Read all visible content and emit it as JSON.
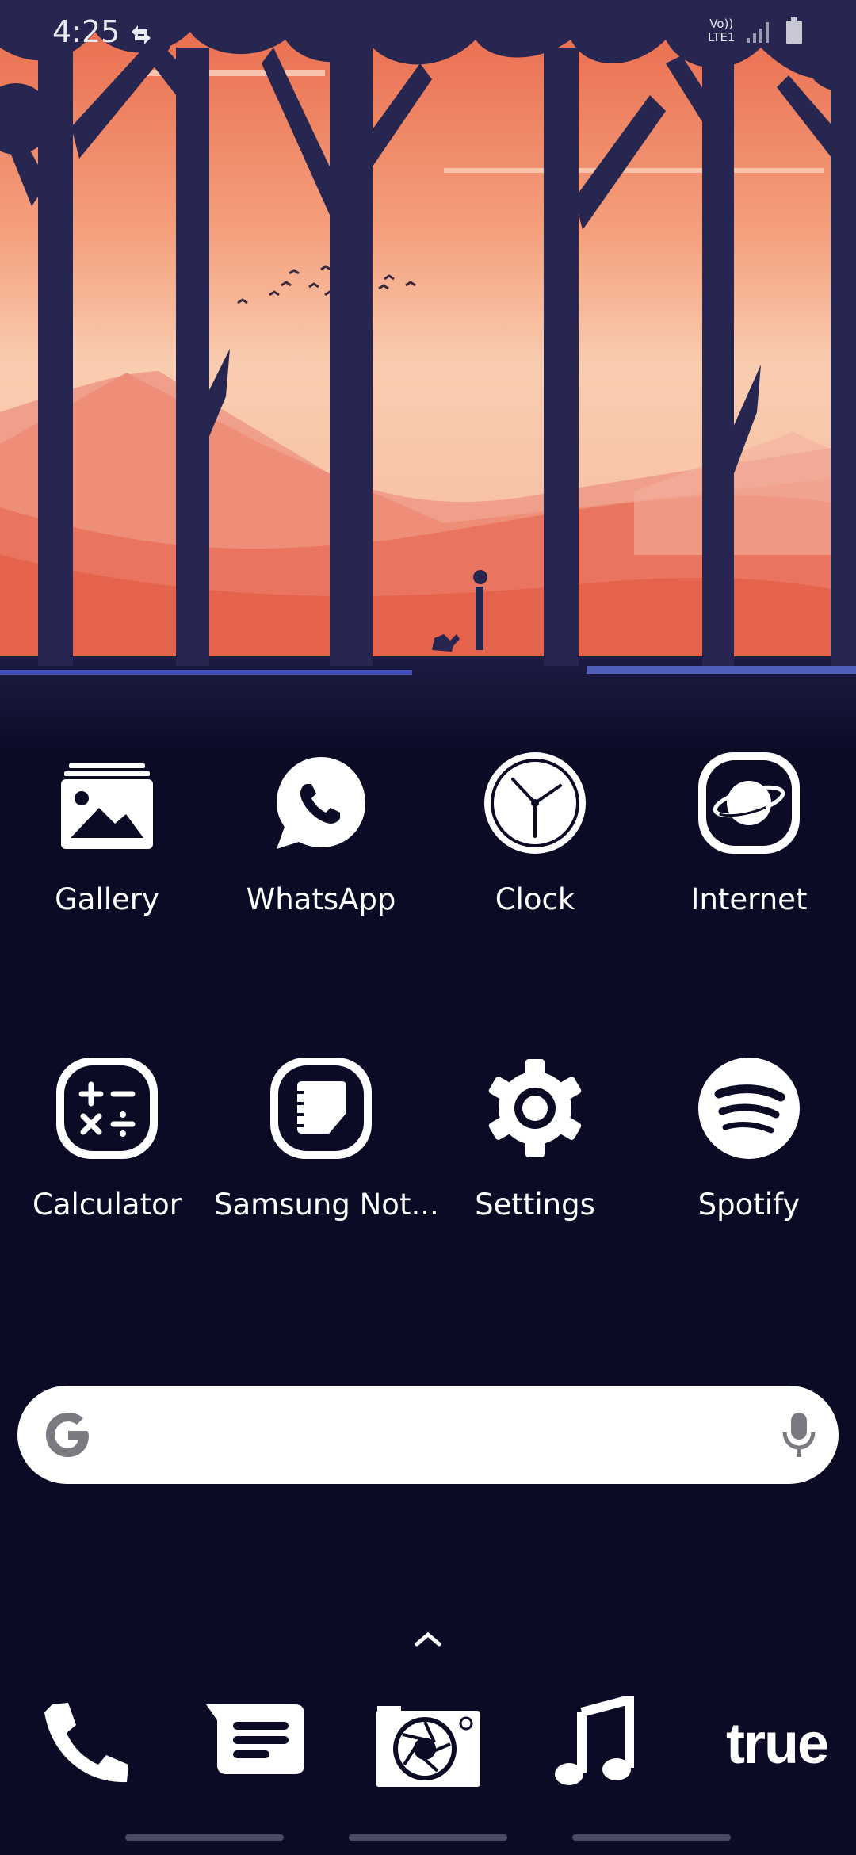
{
  "statusbar": {
    "time": "4:25",
    "network_label_top": "Vo))",
    "network_label_bottom": "LTE1"
  },
  "apps_row1": [
    {
      "label": "Gallery",
      "icon": "gallery-icon"
    },
    {
      "label": "WhatsApp",
      "icon": "whatsapp-icon"
    },
    {
      "label": "Clock",
      "icon": "clock-icon"
    },
    {
      "label": "Internet",
      "icon": "internet-icon"
    }
  ],
  "apps_row2": [
    {
      "label": "Calculator",
      "icon": "calculator-icon"
    },
    {
      "label": "Samsung Not...",
      "icon": "samsung-notes-icon"
    },
    {
      "label": "Settings",
      "icon": "gear-icon"
    },
    {
      "label": "Spotify",
      "icon": "spotify-icon"
    }
  ],
  "search": {
    "logo": "google-g-icon",
    "mic": "mic-icon"
  },
  "dock": [
    {
      "icon": "phone-icon"
    },
    {
      "icon": "messages-icon"
    },
    {
      "icon": "camera-icon"
    },
    {
      "icon": "music-icon"
    },
    {
      "label": "true",
      "icon": "true-app-icon"
    }
  ],
  "colors": {
    "background": "#0b0b26",
    "sky_top": "#e8684a",
    "sky_light": "#f9cdb0",
    "tree": "#262650"
  }
}
